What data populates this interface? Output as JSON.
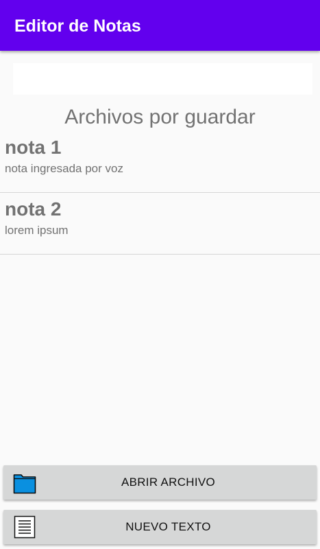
{
  "app_bar": {
    "title": "Editor de Notas",
    "color": "#6200ee"
  },
  "search": {
    "value": "",
    "placeholder": ""
  },
  "section": {
    "title": "Archivos por guardar"
  },
  "notes": [
    {
      "title": "nota 1",
      "subtitle": "nota ingresada por voz"
    },
    {
      "title": "nota 2",
      "subtitle": "lorem ipsum"
    }
  ],
  "buttons": {
    "open": {
      "label": "ABRIR ARCHIVO",
      "icon": "folder-icon"
    },
    "new": {
      "label": "NUEVO TEXTO",
      "icon": "document-icon"
    }
  },
  "colors": {
    "button_bg": "#d6d7d7",
    "text_gray": "#727272",
    "folder_blue": "#0a90e0"
  }
}
